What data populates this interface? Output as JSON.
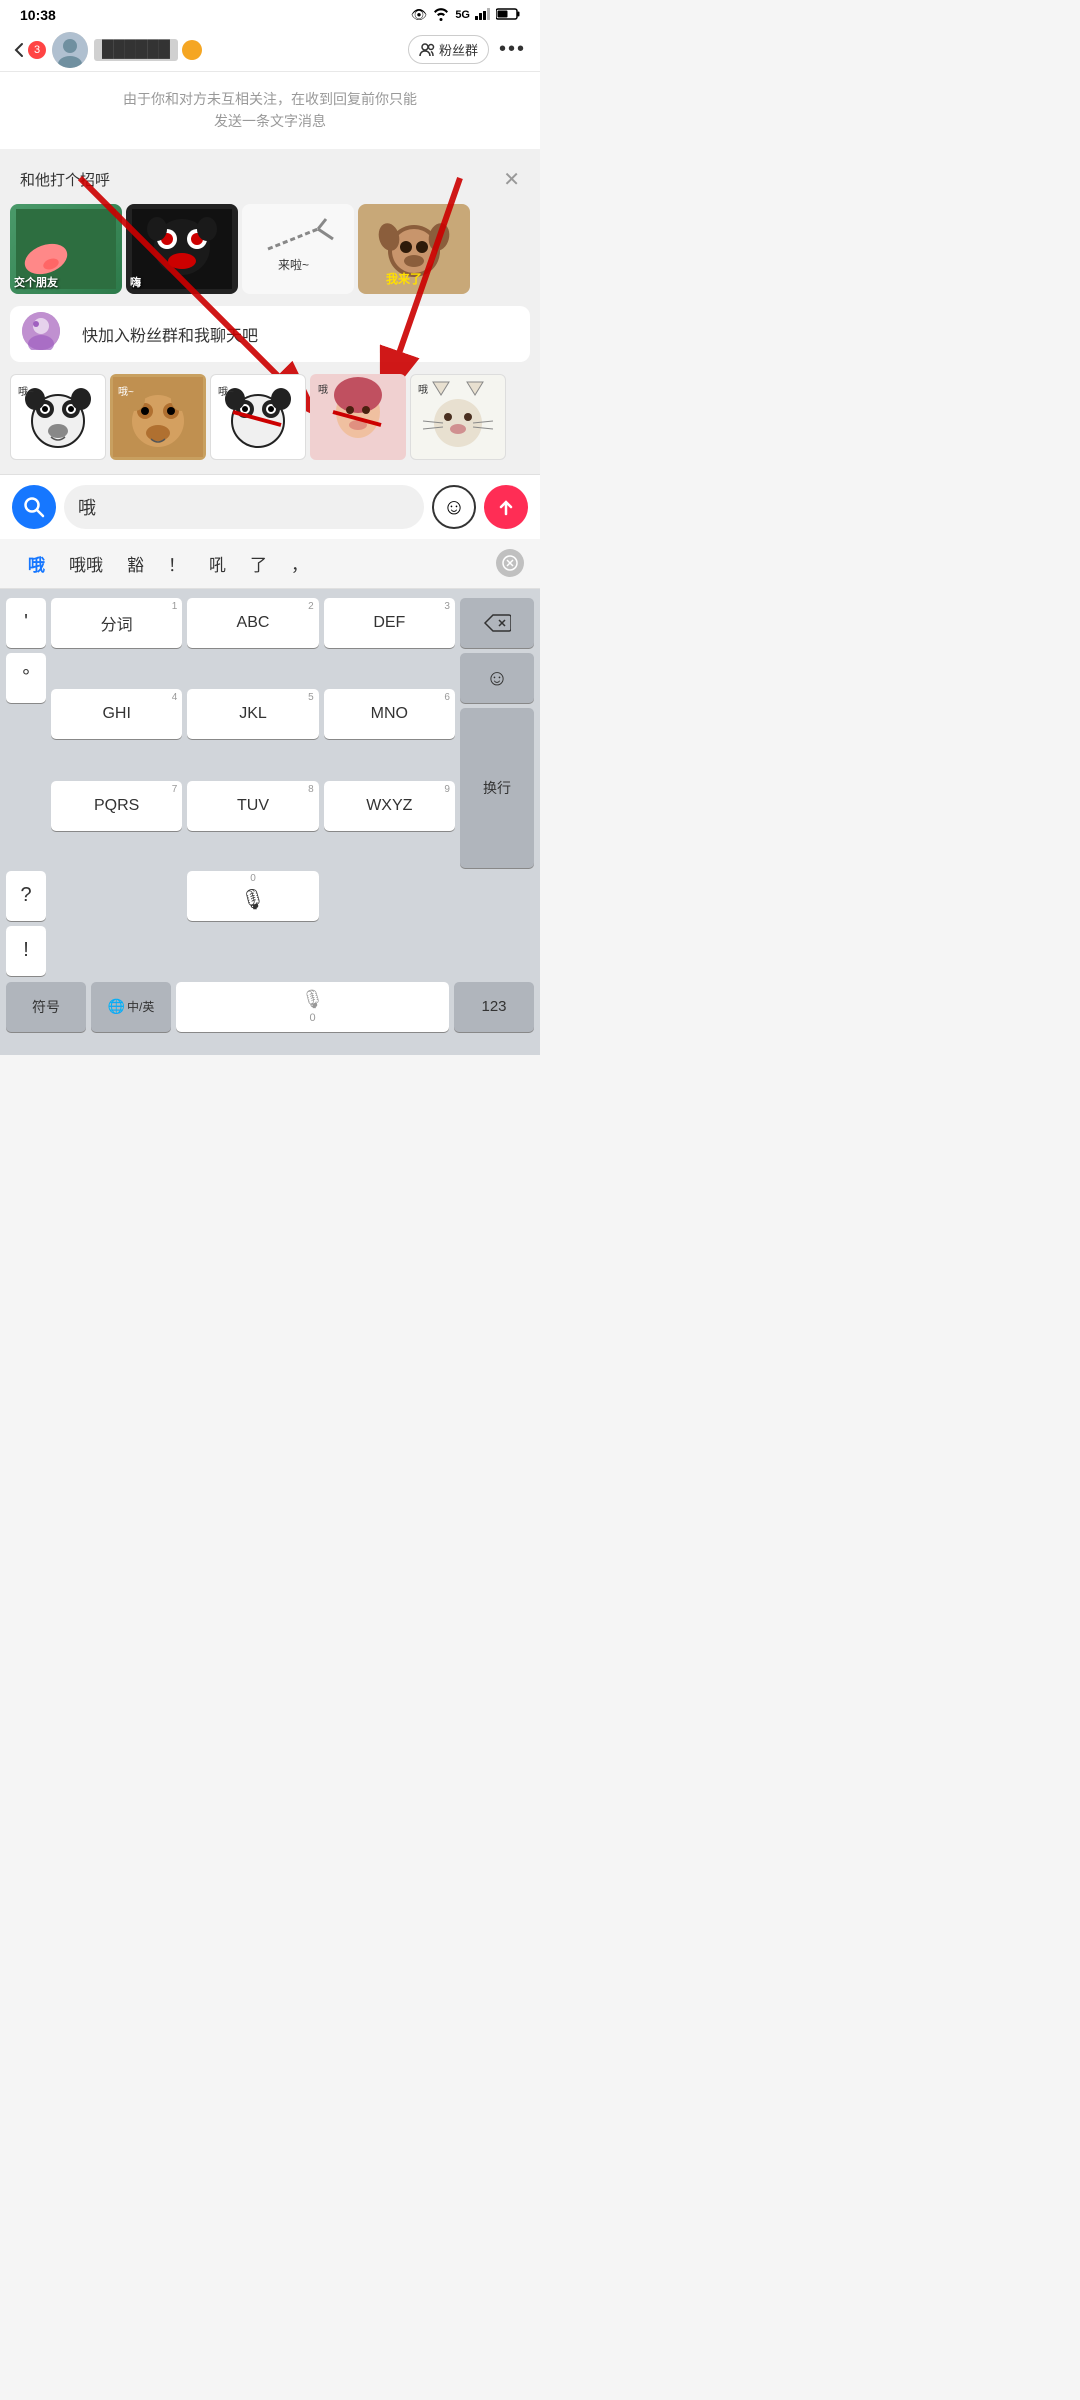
{
  "statusBar": {
    "time": "10:38",
    "icons": "👁 📶 5G 🔋"
  },
  "navBar": {
    "backLabel": "3",
    "fansGroupLabel": "粉丝群",
    "moreLabel": "•••"
  },
  "notice": {
    "text": "由于你和对方未互相关注，在收到回复前你只能\n发送一条文字消息"
  },
  "greeting": {
    "title": "和他打个招呼",
    "closeLabel": "✕"
  },
  "stickers": {
    "top": [
      {
        "label": "交个朋友",
        "type": "green"
      },
      {
        "label": "嗨",
        "type": "dark"
      },
      {
        "label": "来啦~",
        "type": "gesture"
      },
      {
        "label": "我来了",
        "type": "dog"
      }
    ],
    "bottom": [
      {
        "label": "哦~",
        "type": "panda"
      },
      {
        "label": "哦~",
        "type": "bear"
      },
      {
        "label": "哦~",
        "type": "panda2"
      },
      {
        "label": "哦",
        "type": "girl"
      },
      {
        "label": "哦",
        "type": "cat"
      }
    ]
  },
  "chatMessage": {
    "text": "快加入粉丝群和我聊天吧"
  },
  "inputArea": {
    "inputText": "哦",
    "inputPlaceholder": "",
    "searchIconLabel": "🔍",
    "emojiBtnLabel": "☺",
    "sendBtnLabel": "↑"
  },
  "suggestions": {
    "items": [
      {
        "label": "哦",
        "active": true
      },
      {
        "label": "哦哦",
        "active": false
      },
      {
        "label": "豁",
        "active": false
      },
      {
        "label": "！",
        "active": false
      },
      {
        "label": "吼",
        "active": false
      },
      {
        "label": "了",
        "active": false
      },
      {
        "label": "，",
        "active": false
      }
    ],
    "deleteLabel": "⊗"
  },
  "keyboard": {
    "leftKeys": [
      "'",
      "°",
      "?",
      "!"
    ],
    "row1": [
      {
        "num": "1",
        "main": "分词"
      },
      {
        "num": "2",
        "main": "ABC"
      },
      {
        "num": "3",
        "main": "DEF"
      }
    ],
    "row2": [
      {
        "num": "4",
        "main": "GHI"
      },
      {
        "num": "5",
        "main": "JKL"
      },
      {
        "num": "6",
        "main": "MNO"
      }
    ],
    "row3": [
      {
        "num": "7",
        "main": "PQRS"
      },
      {
        "num": "8",
        "main": "TUV"
      },
      {
        "num": "9",
        "main": "WXYZ"
      }
    ],
    "backspaceLabel": "⌫",
    "emojiKeyLabel": "☺",
    "enterLabel": "换行",
    "bottomRow": {
      "symbolsLabel": "符号",
      "langLabel": "中/英",
      "micLabel": "🎙",
      "numLabel": "123"
    }
  }
}
